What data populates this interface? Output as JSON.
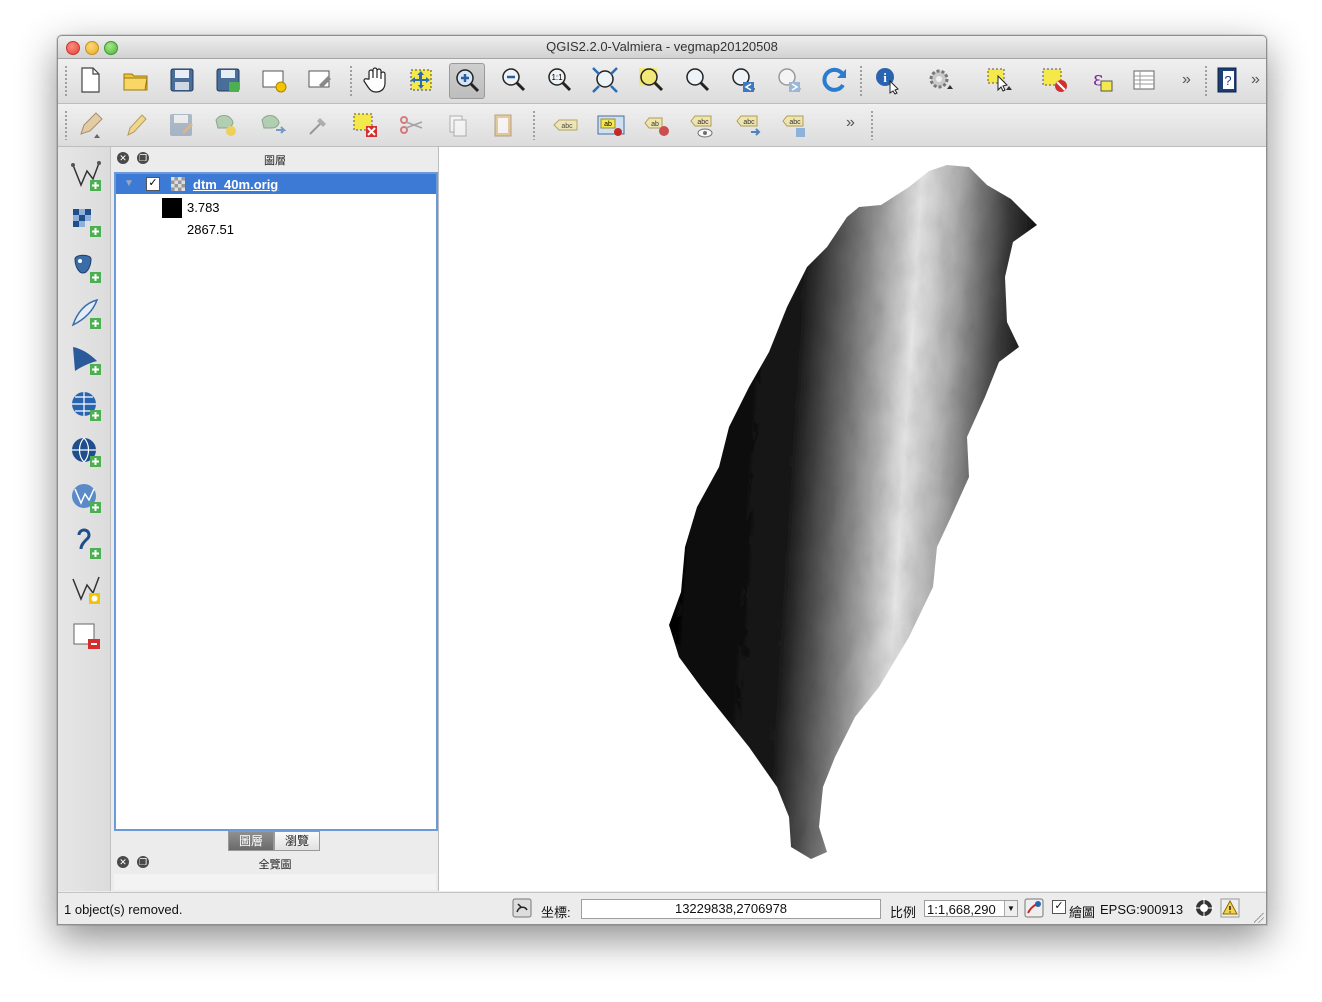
{
  "window": {
    "title": "QGIS2.2.0-Valmiera - vegmap20120508"
  },
  "toolbar_main": {
    "icons": [
      "new-project-icon",
      "open-project-icon",
      "save-project-icon",
      "save-as-icon",
      "new-print-composer-icon",
      "composer-manager-icon",
      "pan-icon",
      "pan-to-selection-icon",
      "zoom-in-icon",
      "zoom-out-icon",
      "zoom-actual-size-icon",
      "zoom-full-icon",
      "zoom-to-selection-icon",
      "zoom-to-layer-icon",
      "zoom-last-icon",
      "zoom-next-icon",
      "refresh-icon",
      "identify-icon",
      "run-action-icon",
      "select-features-icon",
      "deselect-icon",
      "expression-select-icon",
      "attribute-table-icon",
      "help-icon"
    ],
    "overflow": "»"
  },
  "toolbar_edit": {
    "icons": [
      "current-edits-icon",
      "toggle-editing-icon",
      "save-layer-edits-icon",
      "add-feature-icon",
      "move-feature-icon",
      "node-tool-icon",
      "delete-selected-icon",
      "cut-features-icon",
      "copy-features-icon",
      "paste-features-icon",
      "label-icon",
      "layer-labeling-icon",
      "pin-labels-icon",
      "show-hide-labels-icon",
      "move-label-icon",
      "change-label-icon"
    ],
    "overflow": "»"
  },
  "left_toolbar": {
    "icons": [
      "add-vector-layer-icon",
      "add-raster-layer-icon",
      "add-postgis-layer-icon",
      "add-spatialite-layer-icon",
      "add-mssql-layer-icon",
      "add-wms-layer-icon",
      "add-wcs-layer-icon",
      "add-wfs-layer-icon",
      "add-delimited-text-icon",
      "new-shapefile-icon",
      "remove-layer-icon"
    ]
  },
  "layers_panel": {
    "title": "圖層",
    "layer": {
      "name": "dtm_40m.orig",
      "checked": true
    },
    "legend": {
      "min": "3.783",
      "max": "2867.51"
    }
  },
  "tabs": {
    "layers": "圖層",
    "browser": "瀏覽"
  },
  "overview_panel": {
    "title": "全覽圖"
  },
  "status": {
    "message": "1 object(s) removed.",
    "coord_label": "坐標:",
    "coordinates": "13229838,2706978",
    "scale_label": "比例",
    "scale": "1:1,668,290",
    "render_label": "繪圖",
    "render_checked": true,
    "crs": "EPSG:900913"
  }
}
